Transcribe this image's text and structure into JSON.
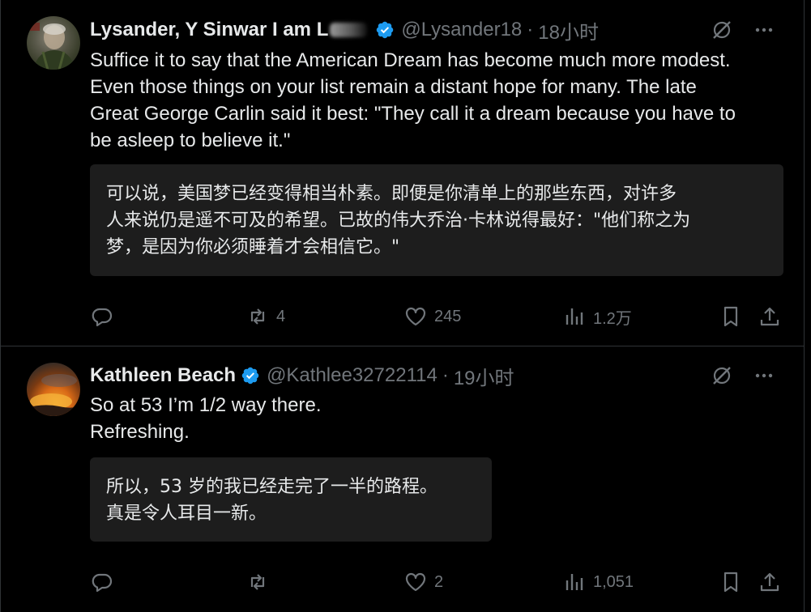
{
  "tweets": [
    {
      "author_name": "Lysander, Y Sinwar I am L",
      "handle": "@Lysander18",
      "separator": "·",
      "time": "18小时",
      "text": "Suffice it to say that the American Dream has become much more modest.\nEven those things on your list remain a distant hope for many. The late\nGreat George Carlin said it best: \"They call it a dream because you have to\nbe asleep to believe it.\"",
      "translation": "可以说，美国梦已经变得相当朴素。即便是你清单上的那些东西，对许多\n人来说仍是遥不可及的希望。已故的伟大乔治·卡林说得最好：\"他们称之为\n梦，是因为你必须睡着才会相信它。\"",
      "stats": {
        "replies": "",
        "reposts": "4",
        "likes": "245",
        "views": "1.2万"
      }
    },
    {
      "author_name": "Kathleen Beach",
      "handle": "@Kathlee32722114",
      "separator": "·",
      "time": "19小时",
      "text": "So at 53 I’m 1/2 way there.\nRefreshing.",
      "translation": "所以，53 岁的我已经走完了一半的路程。\n真是令人耳目一新。",
      "stats": {
        "replies": "",
        "reposts": "",
        "likes": "2",
        "views": "1,051"
      }
    }
  ],
  "colors": {
    "background": "#000000",
    "text": "#e7e9ea",
    "muted": "#71767b",
    "verified": "#1d9bf0",
    "translation_bg": "#1d1d1d",
    "divider": "#2f3336"
  },
  "icons": [
    "verified-badge-icon",
    "grok-icon",
    "more-icon",
    "reply-icon",
    "repost-icon",
    "like-icon",
    "views-icon",
    "bookmark-icon",
    "share-icon"
  ]
}
